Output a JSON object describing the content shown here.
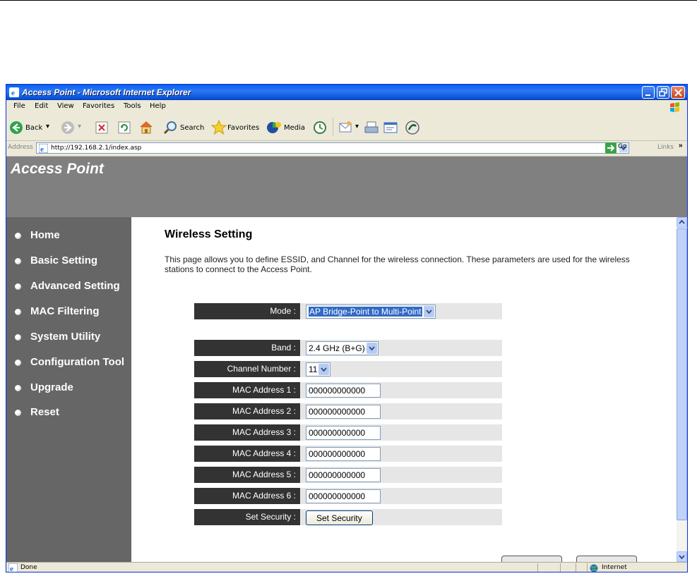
{
  "window": {
    "title": "Access Point - Microsoft Internet Explorer"
  },
  "menu": {
    "items": [
      "File",
      "Edit",
      "View",
      "Favorites",
      "Tools",
      "Help"
    ]
  },
  "toolbar": {
    "back_label": "Back",
    "search_label": "Search",
    "favorites_label": "Favorites",
    "media_label": "Media"
  },
  "address": {
    "label": "Address",
    "url": "http://192.168.2.1/index.asp",
    "go_label": "Go",
    "links_label": "Links"
  },
  "header": {
    "title": "Access Point"
  },
  "sidebar": {
    "items": [
      "Home",
      "Basic Setting",
      "Advanced Setting",
      "MAC Filtering",
      "System Utility",
      "Configuration Tool",
      "Upgrade",
      "Reset"
    ]
  },
  "main": {
    "title": "Wireless Setting",
    "description": "This page allows you to define ESSID, and Channel for the wireless connection. These parameters are used for the wireless stations to connect to the Access Point."
  },
  "form": {
    "mode": {
      "label": "Mode :",
      "value": "AP Bridge-Point to Multi-Point"
    },
    "band": {
      "label": "Band :",
      "value": "2.4 GHz (B+G)"
    },
    "channel": {
      "label": "Channel Number :",
      "value": "11"
    },
    "mac": [
      {
        "label": "MAC Address 1 :",
        "value": "000000000000"
      },
      {
        "label": "MAC Address 2 :",
        "value": "000000000000"
      },
      {
        "label": "MAC Address 3 :",
        "value": "000000000000"
      },
      {
        "label": "MAC Address 4 :",
        "value": "000000000000"
      },
      {
        "label": "MAC Address 5 :",
        "value": "000000000000"
      },
      {
        "label": "MAC Address 6 :",
        "value": "000000000000"
      }
    ],
    "security": {
      "label": "Set Security :",
      "button": "Set Security"
    }
  },
  "status": {
    "text": "Done",
    "zone": "Internet"
  },
  "colors": {
    "header_bg": "#808080",
    "sidebar_bg": "#666666",
    "label_bg": "#333333",
    "row_bg": "#e6e6e6",
    "titlebar": "#0a5ff0"
  }
}
